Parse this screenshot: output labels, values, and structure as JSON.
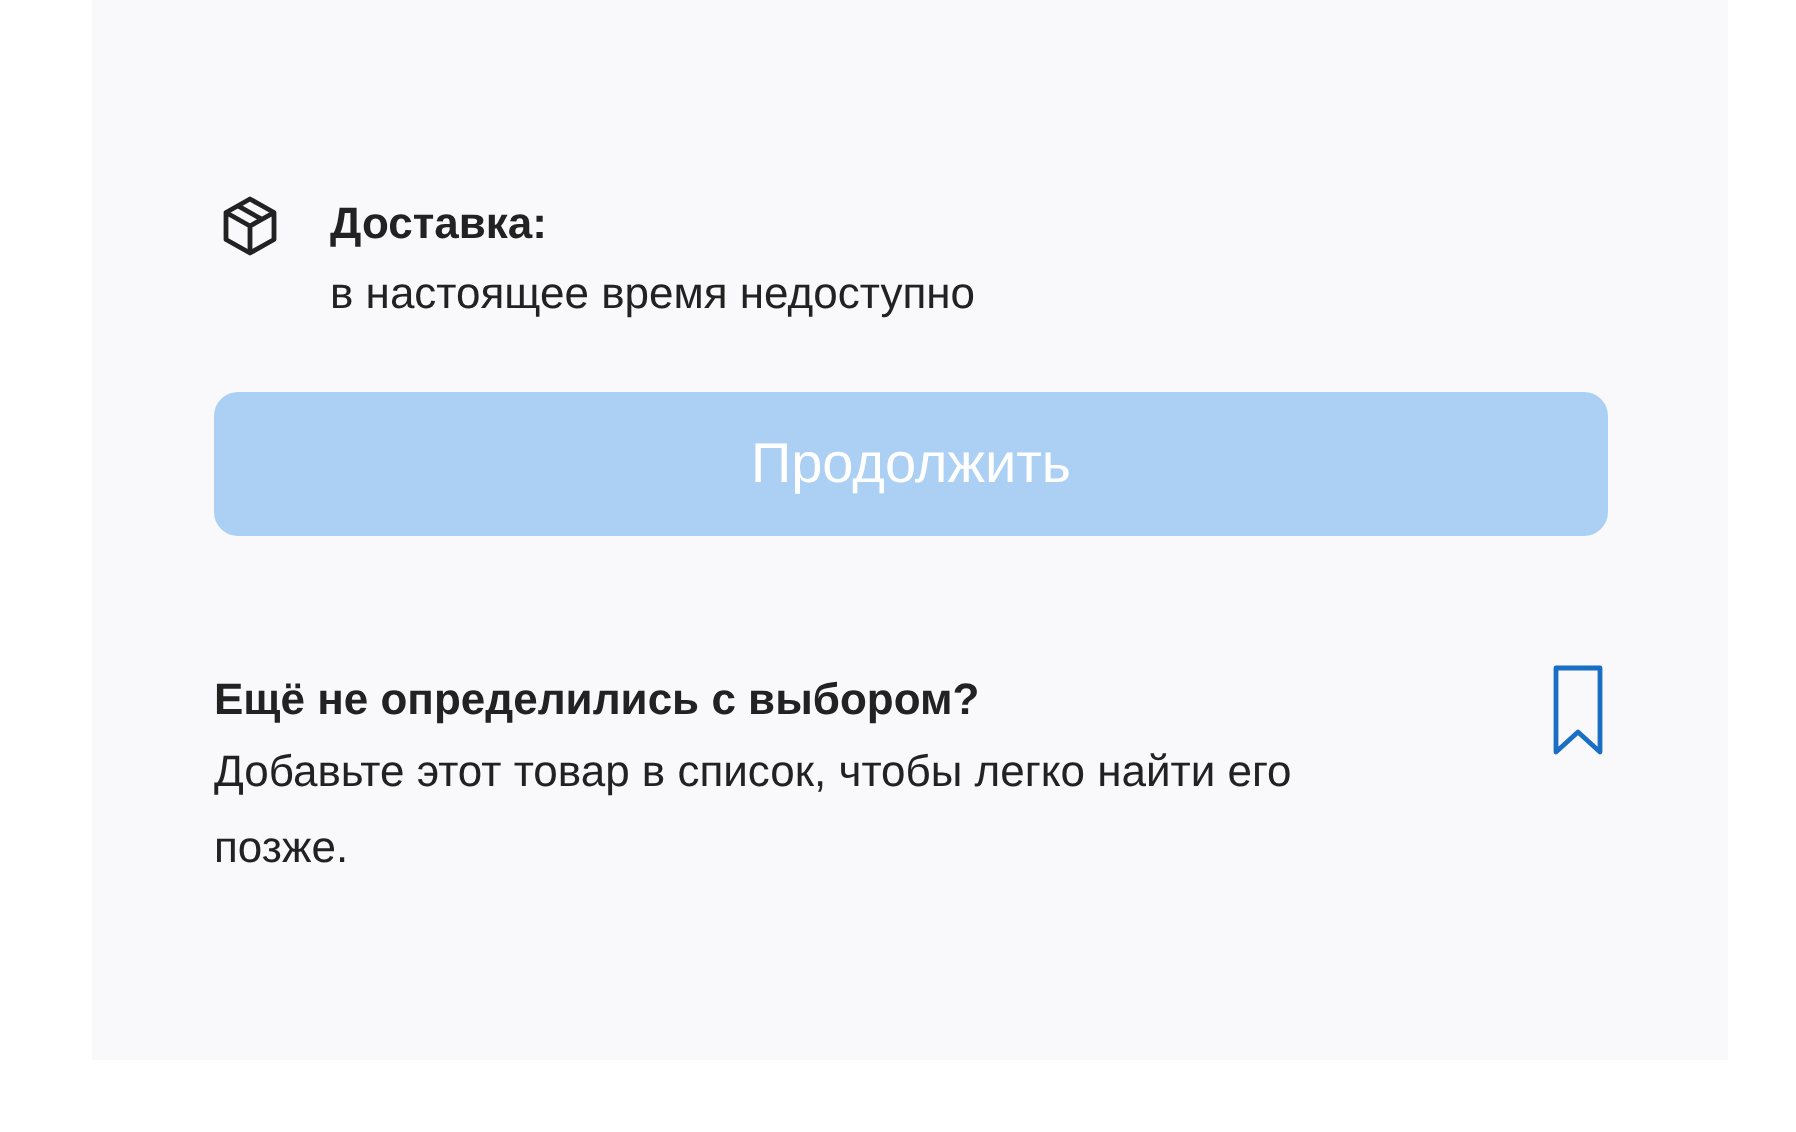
{
  "delivery": {
    "title": "Доставка:",
    "status": "в настоящее время недоступно"
  },
  "continue_button": {
    "label": "Продолжить",
    "disabled": true
  },
  "wishlist": {
    "title": "Ещё не определились с выбором?",
    "text": "Добавьте этот товар в список, чтобы легко найти его позже."
  }
}
